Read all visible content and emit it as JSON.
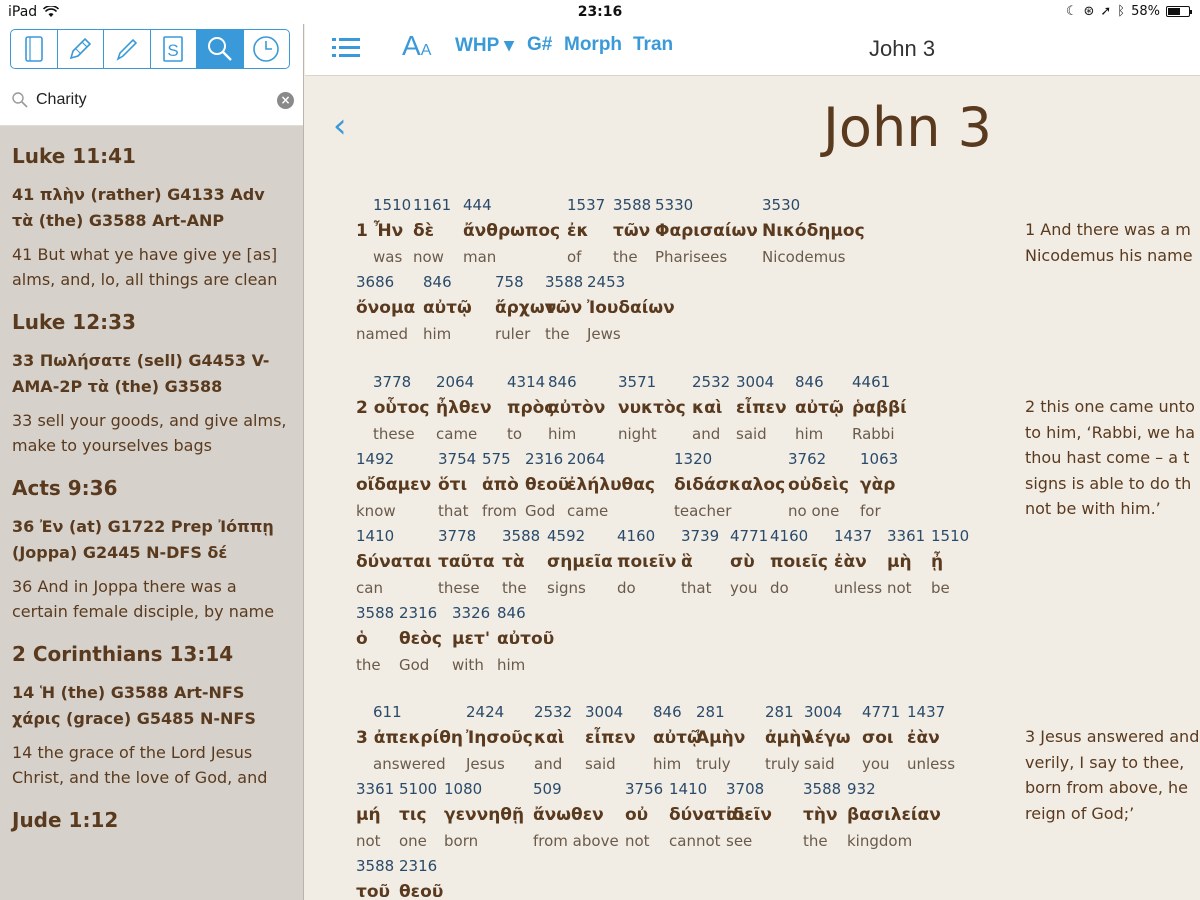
{
  "status": {
    "device": "iPad",
    "time": "23:16",
    "battery": "58%",
    "battery_level": 0.58
  },
  "sidebar": {
    "tools": [
      "book-icon",
      "edit-icon",
      "pencil-icon",
      "strongs-icon",
      "search-icon",
      "history-icon"
    ],
    "strongs_label": "S",
    "search": {
      "value": "Charity"
    },
    "results": [
      {
        "ref": "Luke 11:41",
        "greek": "41 πλὴν (rather) G4133 Adv τὰ (the) G3588 Art-ANP",
        "english": "41 But what ye have give ye [as] alms, and, lo, all things are clean"
      },
      {
        "ref": "Luke 12:33",
        "greek": "33 Πωλήσατε (sell) G4453 V-AMA-2P τὰ (the) G3588",
        "english": "33 sell your goods, and give alms, make to yourselves bags"
      },
      {
        "ref": "Acts 9:36",
        "greek": "36 Ἐν (at) G1722 Prep Ἰόππῃ (Joppa) G2445 N-DFS δέ",
        "english": "36 And in Joppa there was a certain female disciple, by name"
      },
      {
        "ref": "2 Corinthians 13:14",
        "greek": "14 Ἡ (the) G3588 Art-NFS χάρις (grace) G5485 N-NFS",
        "english": "14 the grace of the Lord Jesus Christ, and the love of God, and"
      },
      {
        "ref": "Jude 1:12",
        "greek": "",
        "english": ""
      }
    ]
  },
  "toolbar": {
    "font_label_big": "A",
    "font_label_small": "A",
    "whp": "WHP ▾",
    "gnum": "G#",
    "morph": "Morph",
    "tran": "Tran",
    "chapter": "John 3"
  },
  "pane": {
    "back": "‹",
    "title": "John 3",
    "verses": [
      {
        "lines": [
          [
            {
              "num": "1510",
              "gk": "1 Ἦν",
              "en": "was"
            },
            {
              "num": "1161",
              "gk": "δὲ",
              "en": "now"
            },
            {
              "num": "444",
              "gk": "ἄνθρωπος",
              "en": "man"
            },
            {
              "num": "1537",
              "gk": "ἐκ",
              "en": "of"
            },
            {
              "num": "3588",
              "gk": "τῶν",
              "en": "the"
            },
            {
              "num": "5330",
              "gk": "Φαρισαίων",
              "en": "Pharisees"
            },
            {
              "num": "3530",
              "gk": "Νικόδημος",
              "en": "Nicodemus"
            }
          ],
          [
            {
              "num": "3686",
              "gk": "ὄνομα",
              "en": "named"
            },
            {
              "num": "846",
              "gk": "αὐτῷ",
              "en": "him"
            },
            {
              "num": "758",
              "gk": "ἄρχων",
              "en": "ruler"
            },
            {
              "num": "3588",
              "gk": "τῶν",
              "en": "the"
            },
            {
              "num": "2453",
              "gk": "Ἰουδαίων",
              "en": "Jews"
            }
          ]
        ],
        "translation": [
          "1 And there was a m",
          "Nicodemus his name"
        ]
      },
      {
        "lines": [
          [
            {
              "num": "3778",
              "gk": "2 οὗτος",
              "en": "these"
            },
            {
              "num": "2064",
              "gk": "ἦλθεν",
              "en": "came"
            },
            {
              "num": "4314",
              "gk": "πρὸς",
              "en": "to"
            },
            {
              "num": "846",
              "gk": "αὐτὸν",
              "en": "him"
            },
            {
              "num": "3571",
              "gk": "νυκτὸς",
              "en": "night"
            },
            {
              "num": "2532",
              "gk": "καὶ",
              "en": "and"
            },
            {
              "num": "3004",
              "gk": "εἶπεν",
              "en": "said"
            },
            {
              "num": "846",
              "gk": "αὐτῷ",
              "en": "him"
            },
            {
              "num": "4461",
              "gk": "ῥαββί",
              "en": "Rabbi"
            }
          ],
          [
            {
              "num": "1492",
              "gk": "οἴδαμεν",
              "en": "know"
            },
            {
              "num": "3754",
              "gk": "ὅτι",
              "en": "that"
            },
            {
              "num": "575",
              "gk": "ἀπὸ",
              "en": "from"
            },
            {
              "num": "2316",
              "gk": "θεοῦ",
              "en": "God"
            },
            {
              "num": "2064",
              "gk": "ἐλήλυθας",
              "en": "came"
            },
            {
              "num": "1320",
              "gk": "διδάσκαλος",
              "en": "teacher"
            },
            {
              "num": "3762",
              "gk": "οὐδεὶς",
              "en": "no one"
            },
            {
              "num": "1063",
              "gk": "γὰρ",
              "en": "for"
            }
          ],
          [
            {
              "num": "1410",
              "gk": "δύναται",
              "en": "can"
            },
            {
              "num": "3778",
              "gk": "ταῦτα",
              "en": "these"
            },
            {
              "num": "3588",
              "gk": "τὰ",
              "en": "the"
            },
            {
              "num": "4592",
              "gk": "σημεῖα",
              "en": "signs"
            },
            {
              "num": "4160",
              "gk": "ποιεῖν",
              "en": "do"
            },
            {
              "num": "3739",
              "gk": "ἃ",
              "en": "that"
            },
            {
              "num": "4771",
              "gk": "σὺ",
              "en": "you"
            },
            {
              "num": "4160",
              "gk": "ποιεῖς",
              "en": "do"
            },
            {
              "num": "1437",
              "gk": "ἐὰν",
              "en": "unless"
            },
            {
              "num": "3361",
              "gk": "μὴ",
              "en": "not"
            },
            {
              "num": "1510",
              "gk": "ᾖ",
              "en": "be"
            }
          ],
          [
            {
              "num": "3588",
              "gk": "ὁ",
              "en": "the"
            },
            {
              "num": "2316",
              "gk": "θεὸς",
              "en": "God"
            },
            {
              "num": "3326",
              "gk": "μετ'",
              "en": "with"
            },
            {
              "num": "846",
              "gk": "αὐτοῦ",
              "en": "him"
            }
          ]
        ],
        "translation": [
          "2 this one came unto",
          "to him, ‘Rabbi, we ha",
          "thou hast come – a t",
          "signs is able to do th",
          "not be with him.’"
        ]
      },
      {
        "lines": [
          [
            {
              "num": "611",
              "gk": "3 ἀπεκρίθη",
              "en": "answered"
            },
            {
              "num": "2424",
              "gk": "Ἰησοῦς",
              "en": "Jesus"
            },
            {
              "num": "2532",
              "gk": "καὶ",
              "en": "and"
            },
            {
              "num": "3004",
              "gk": "εἶπεν",
              "en": "said"
            },
            {
              "num": "846",
              "gk": "αὐτῷ",
              "en": "him"
            },
            {
              "num": "281",
              "gk": "Ἀμὴν",
              "en": "truly"
            },
            {
              "num": "281",
              "gk": "ἀμὴν",
              "en": "truly"
            },
            {
              "num": "3004",
              "gk": "λέγω",
              "en": "said"
            },
            {
              "num": "4771",
              "gk": "σοι",
              "en": "you"
            },
            {
              "num": "1437",
              "gk": "ἐὰν",
              "en": "unless"
            }
          ],
          [
            {
              "num": "3361",
              "gk": "μή",
              "en": "not"
            },
            {
              "num": "5100",
              "gk": "τις",
              "en": "one"
            },
            {
              "num": "1080",
              "gk": "γεννηθῇ",
              "en": "born"
            },
            {
              "num": "509",
              "gk": "ἄνωθεν",
              "en": "from above"
            },
            {
              "num": "3756",
              "gk": "οὐ",
              "en": "not"
            },
            {
              "num": "1410",
              "gk": "δύναται",
              "en": "cannot"
            },
            {
              "num": "3708",
              "gk": "ἰδεῖν",
              "en": "see"
            },
            {
              "num": "3588",
              "gk": "τὴν",
              "en": "the"
            },
            {
              "num": "932",
              "gk": "βασιλείαν",
              "en": "kingdom"
            }
          ],
          [
            {
              "num": "3588",
              "gk": "τοῦ",
              "en": ""
            },
            {
              "num": "2316",
              "gk": "θεοῦ",
              "en": ""
            }
          ]
        ],
        "translation": [
          "3 Jesus answered and",
          "verily, I say to thee,",
          "born from above, he",
          "reign of God;’"
        ]
      }
    ]
  }
}
